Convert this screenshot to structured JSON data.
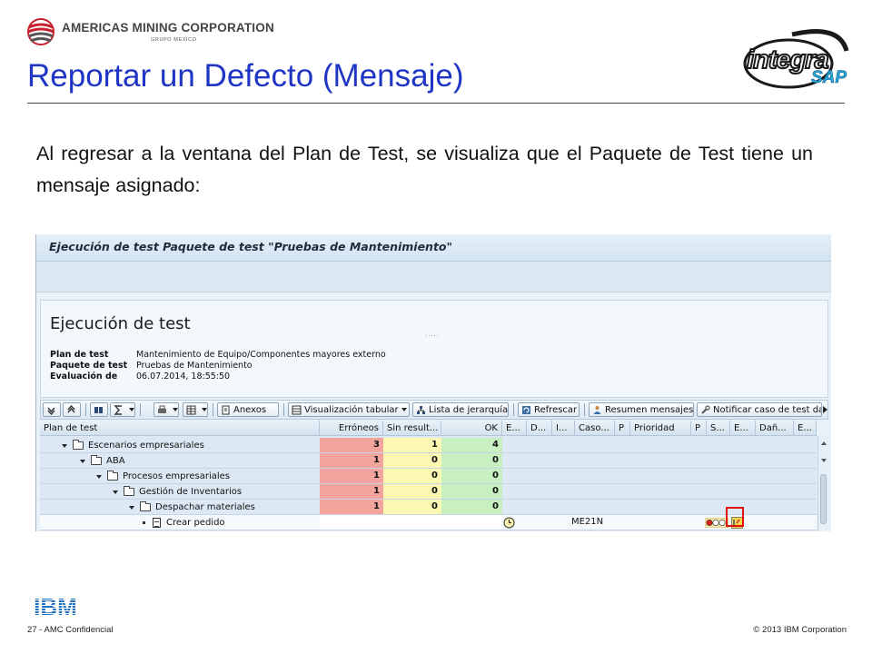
{
  "header": {
    "company_name": "AMERICAS MINING CORPORATION",
    "company_sub": "GRUPO MEXICO",
    "title": "Reportar un Defecto (Mensaje)",
    "integra_text": "integra",
    "sap_text": "SAP"
  },
  "intro_text": "Al regresar a la ventana del Plan de Test, se visualiza que el Paquete de Test tiene un mensaje asignado:",
  "sap_window": {
    "title": "Ejecución de test Paquete de test \"Pruebas de Mantenimiento\"",
    "panel_title": "Ejecución de test",
    "info": [
      {
        "label": "Plan de test",
        "value": "Mantenimiento de Equipo/Componentes mayores externo"
      },
      {
        "label": "Paquete de test",
        "value": "Pruebas de Mantenimiento"
      },
      {
        "label": "Evaluación de",
        "value": "06.07.2014, 18:55:50"
      }
    ],
    "panel_dots": ".....",
    "toolbar": {
      "anexos": "Anexos",
      "visualizacion": "Visualización tabular",
      "lista": "Lista de jerarquía",
      "refrescar": "Refrescar",
      "resumen": "Resumen mensajes",
      "notificar": "Notificar caso de test da"
    },
    "columns": {
      "plan": "Plan de test",
      "erroneos": "Erróneos",
      "sin_result": "Sin result...",
      "ok": "OK",
      "e1": "E...",
      "d": "D...",
      "i": "I...",
      "caso": "Caso...",
      "p1": "P",
      "prioridad": "Prioridad",
      "p2": "P",
      "s": "S...",
      "e2": "E...",
      "dan": "Dañ...",
      "e3": "E..."
    },
    "rows": [
      {
        "name": "Escenarios empresariales",
        "erroneos": "3",
        "sin_result": "1",
        "ok": "4"
      },
      {
        "name": "ABA",
        "erroneos": "1",
        "sin_result": "0",
        "ok": "0"
      },
      {
        "name": "Procesos empresariales",
        "erroneos": "1",
        "sin_result": "0",
        "ok": "0"
      },
      {
        "name": "Gestión de Inventarios",
        "erroneos": "1",
        "sin_result": "0",
        "ok": "0"
      },
      {
        "name": "Despachar materiales",
        "erroneos": "1",
        "sin_result": "0",
        "ok": "0"
      },
      {
        "name": "Crear pedido",
        "transaction": "ME21N"
      }
    ]
  },
  "footer": {
    "ibm": "IBM",
    "left": "27 - AMC Confidencial",
    "right": "© 2013 IBM Corporation"
  },
  "colors": {
    "title_blue": "#1f35c4",
    "error_red": "#f3a59d",
    "pending_yellow": "#fcf7b3",
    "ok_green": "#c8efbf",
    "ibm_blue": "#1f70c1"
  }
}
